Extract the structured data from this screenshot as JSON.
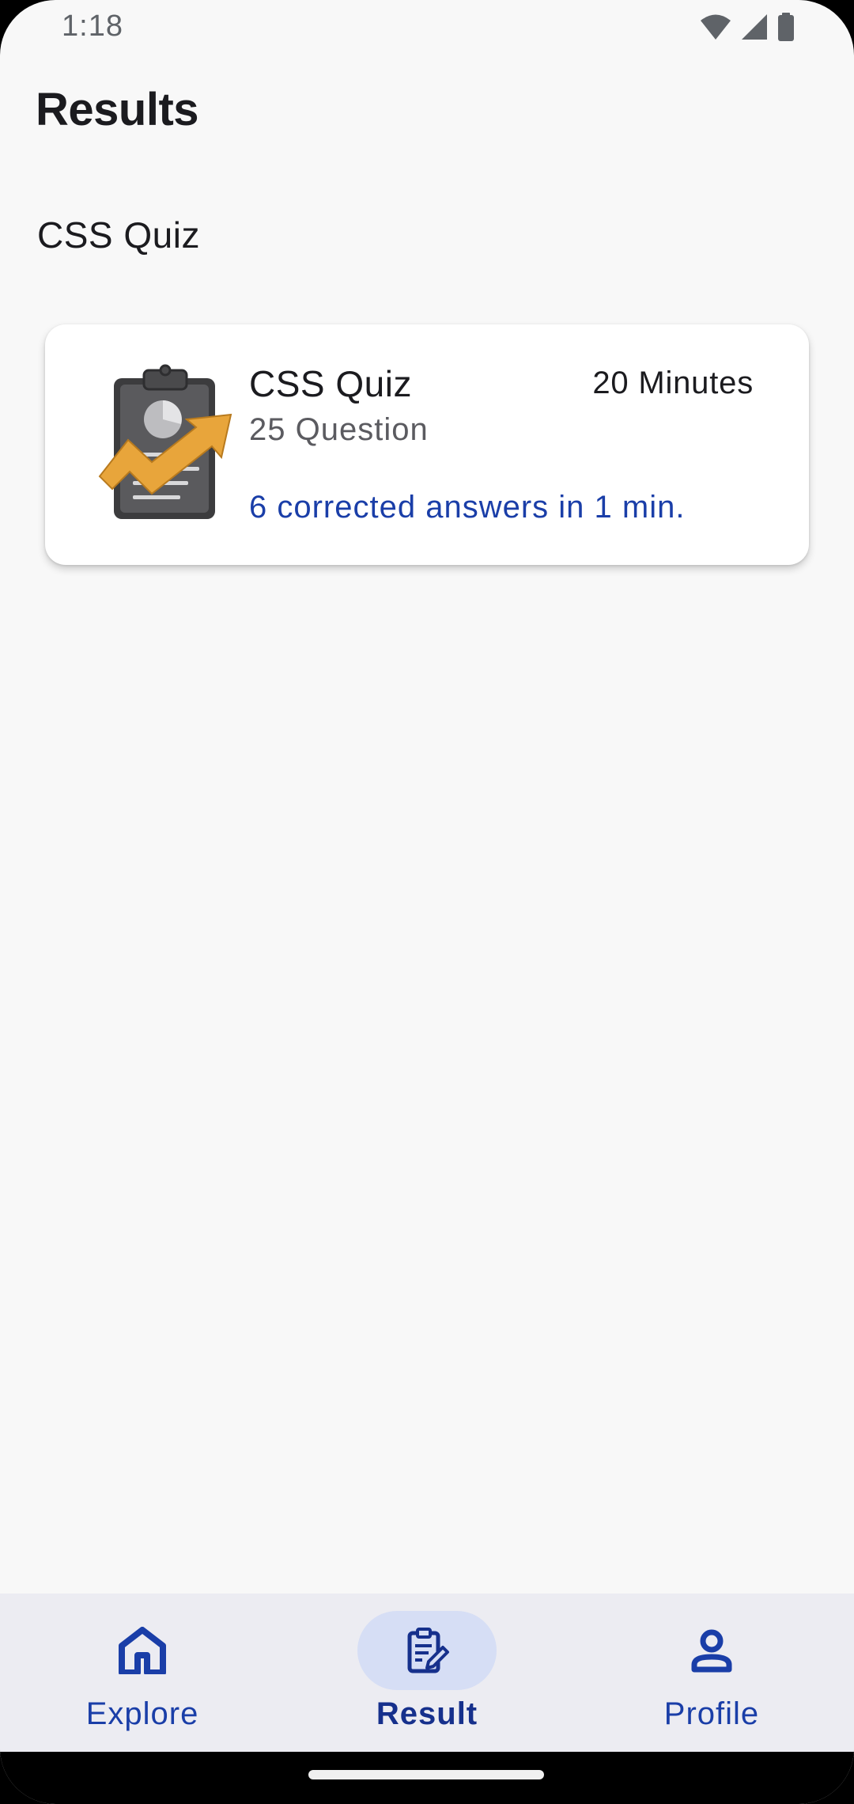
{
  "status_bar": {
    "time": "1:18",
    "icons": [
      "wifi-icon",
      "cellular-signal-icon",
      "battery-icon"
    ]
  },
  "app_bar": {
    "title": "Results"
  },
  "section": {
    "title": "CSS Quiz"
  },
  "result_card": {
    "image": "clipboard-growth-chart-icon",
    "title": "CSS Quiz",
    "duration": "20 Minutes",
    "questions": "25 Question",
    "summary": "6 corrected answers in 1 min."
  },
  "bottom_nav": {
    "selected": "Result",
    "items": [
      {
        "label": "Explore",
        "icon": "home-icon"
      },
      {
        "label": "Result",
        "icon": "clipboard-edit-icon"
      },
      {
        "label": "Profile",
        "icon": "person-icon"
      }
    ]
  },
  "colors": {
    "background": "#f8f8f8",
    "accent": "#1a3ea8",
    "nav_background": "#ececf2",
    "nav_indicator": "#d6def5"
  }
}
